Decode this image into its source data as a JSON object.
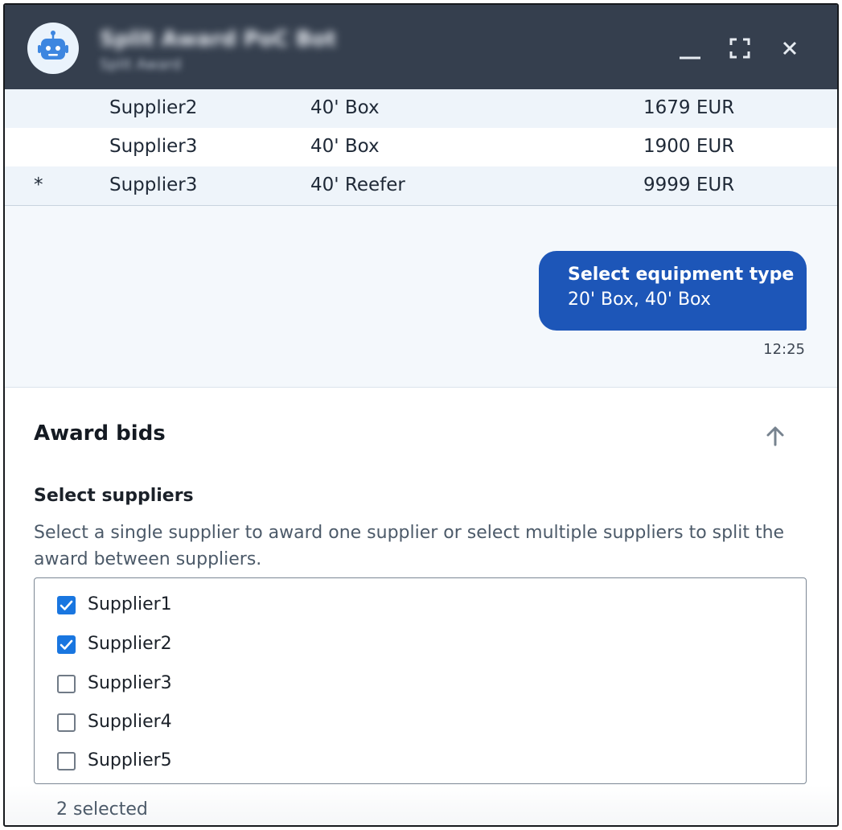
{
  "header": {
    "bot_name": "Split Award PoC Bot",
    "bot_subtitle": "Split Award",
    "minimize_icon": "minimize-icon",
    "maximize_icon": "maximize-icon",
    "close_icon": "close-icon"
  },
  "table": {
    "rows": [
      {
        "mark": "",
        "supplier": "Supplier2",
        "type": "40' Box",
        "price": "1679 EUR"
      },
      {
        "mark": "",
        "supplier": "Supplier3",
        "type": "40' Box",
        "price": "1900 EUR"
      },
      {
        "mark": "*",
        "supplier": "Supplier3",
        "type": "40' Reefer",
        "price": "9999 EUR"
      }
    ]
  },
  "message": {
    "title": "Select equipment type",
    "value": "20' Box, 40' Box",
    "time": "12:25"
  },
  "award": {
    "title": "Award bids",
    "collapse_icon": "arrow-up-icon",
    "field_label": "Select suppliers",
    "help_text": "Select a single supplier to award one supplier or select multiple suppliers to split the award between suppliers.",
    "options": [
      {
        "label": "Supplier1",
        "checked": true
      },
      {
        "label": "Supplier2",
        "checked": true
      },
      {
        "label": "Supplier3",
        "checked": false
      },
      {
        "label": "Supplier4",
        "checked": false
      },
      {
        "label": "Supplier5",
        "checked": false
      }
    ],
    "selected_count": "2 selected"
  },
  "colors": {
    "header_bg": "#353f4e",
    "bubble_bg": "#1d56b8",
    "checkbox_on": "#1976e0"
  }
}
